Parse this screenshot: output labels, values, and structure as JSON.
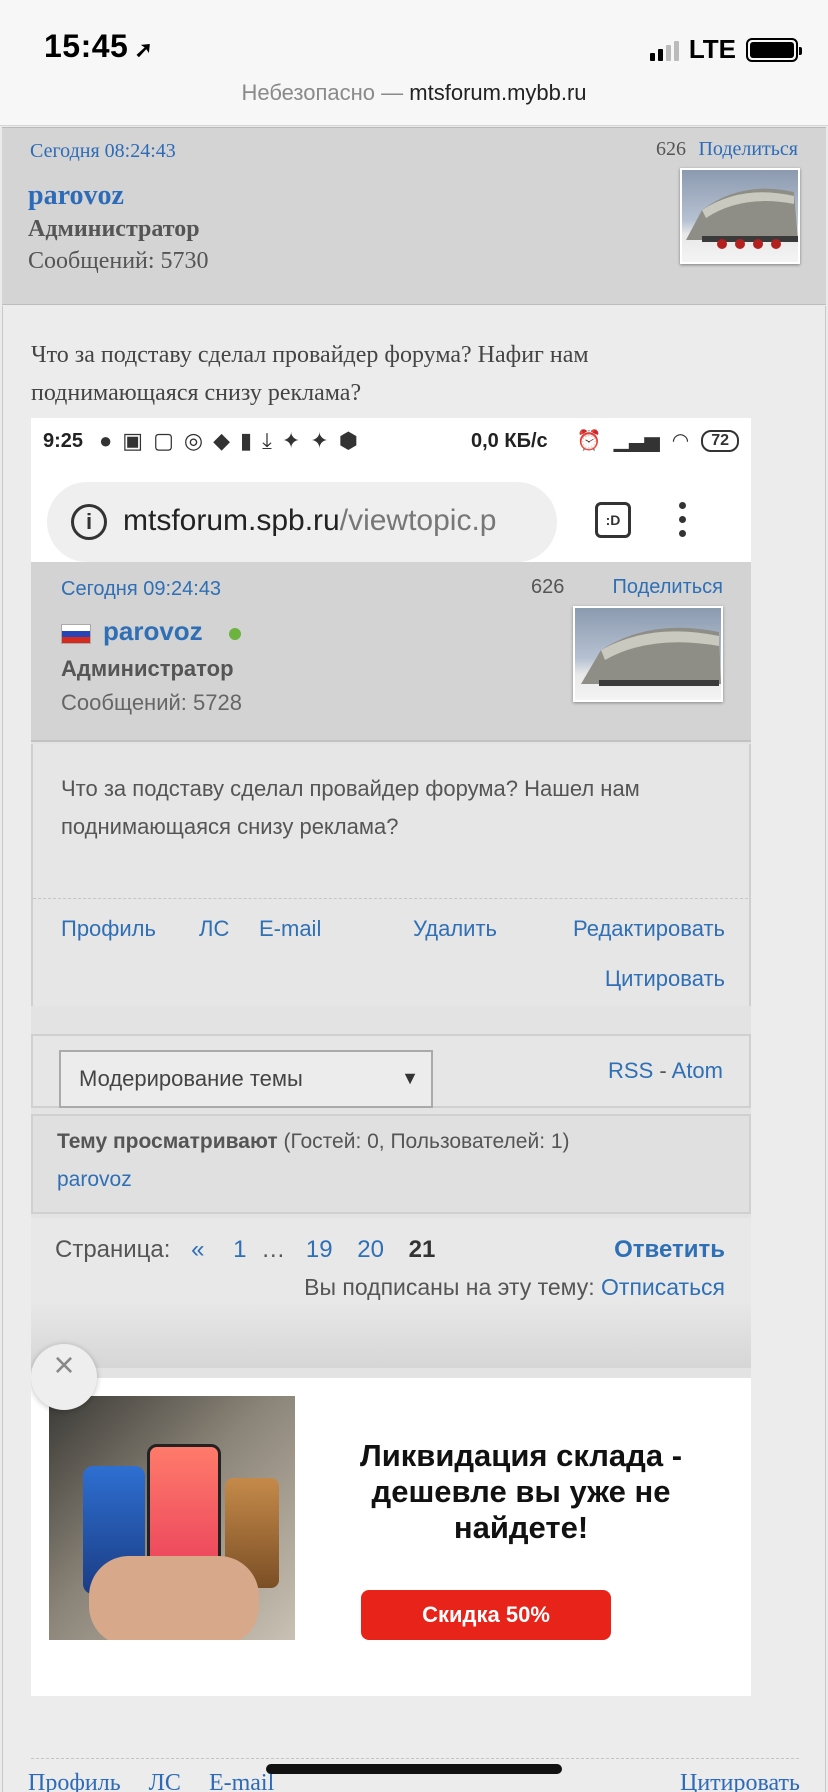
{
  "ios": {
    "time": "15:45",
    "network": "LTE",
    "url_prefix": "Небезопасно — ",
    "url_host": "mtsforum.mybb.ru"
  },
  "post": {
    "date": "Сегодня 08:24:43",
    "number": "626",
    "share": "Поделиться",
    "username": "parovoz",
    "role": "Администратор",
    "posts_count": "Сообщений: 5730",
    "text": "Что за подставу сделал провайдер форума? Нафиг нам поднимающаяся снизу реклама?"
  },
  "screenshot": {
    "status": {
      "time": "9:25",
      "speed": "0,0 КБ/с",
      "battery": "72"
    },
    "url_main": "mtsforum.spb.ru",
    "url_path": "/viewtopic.p",
    "tabs_label": ":D",
    "post": {
      "date": "Сегодня 09:24:43",
      "number": "626",
      "share": "Поделиться",
      "username": "parovoz",
      "role": "Администратор",
      "posts_count": "Сообщений: 5728",
      "text": "Что за подставу сделал провайдер форума? Нашел нам поднимающаяся снизу реклама?"
    },
    "actions": {
      "profile": "Профиль",
      "pm": "ЛС",
      "email": "E-mail",
      "delete": "Удалить",
      "edit": "Редактировать",
      "quote": "Цитировать"
    },
    "moderation": {
      "select_value": "Модерирование темы",
      "rss": "RSS",
      "dash": "-",
      "atom": "Atom"
    },
    "viewers": {
      "label": "Тему просматривают",
      "counts": " (Гостей: 0, Пользователей: 1)",
      "user": "parovoz"
    },
    "pagination": {
      "label": "Страница:",
      "prev": "«",
      "p1": "1",
      "ellipsis": "…",
      "p19": "19",
      "p20": "20",
      "current": "21",
      "reply": "Ответить",
      "subscribed": "Вы подписаны на эту тему: ",
      "unsubscribe": "Отписаться"
    },
    "ad": {
      "title": "Ликвидация склада - дешевле вы уже не найдете!",
      "button": "Скидка 50%",
      "close": "×"
    }
  },
  "bottom": {
    "profile": "Профиль",
    "pm": "ЛС",
    "email": "E-mail",
    "quote": "Цитировать"
  }
}
